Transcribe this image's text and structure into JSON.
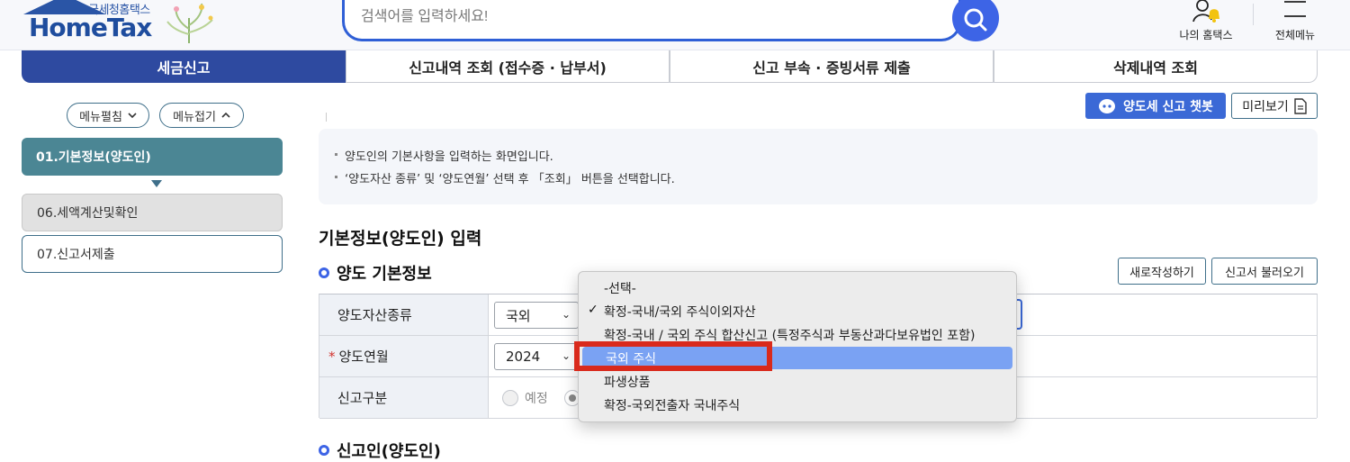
{
  "header": {
    "logo_sub": "국세청홈택스",
    "logo_main": "HomeTax",
    "search_placeholder": "검색어를 입력하세요!",
    "my_hometax": "나의 홈택스",
    "all_menu": "전체메뉴"
  },
  "tabs": [
    {
      "label": "세금신고"
    },
    {
      "label": "신고내역 조회 (접수증 · 납부서)"
    },
    {
      "label": "신고 부속 · 증빙서류 제출"
    },
    {
      "label": "삭제내역 조회"
    }
  ],
  "sidebar": {
    "expand_label": "메뉴펼침",
    "collapse_label": "메뉴접기",
    "steps": [
      {
        "label": "01.기본정보(양도인)"
      },
      {
        "label": "06.세액계산및확인"
      },
      {
        "label": "07.신고서제출"
      }
    ]
  },
  "toolbar": {
    "chatbot_label": "양도세 신고 챗봇",
    "preview_label": "미리보기"
  },
  "info": {
    "line1": "양도인의 기본사항을 입력하는 화면입니다.",
    "line2": "‘양도자산 종류’ 및 ‘양도연월’ 선택 후 「조회」 버튼을 선택합니다."
  },
  "section": {
    "title": "기본정보(양도인) 입력",
    "sub1": "양도 기본정보",
    "sub2": "신고인(양도인)",
    "new_btn": "새로작성하기",
    "load_btn": "신고서 불러오기"
  },
  "form": {
    "asset_type_label": "양도자산종류",
    "asset_type_value": "국외",
    "month_label": "양도연월",
    "required_mark": "*",
    "year_value": "2024",
    "report_type_label": "신고구분",
    "radio1_label": "예정"
  },
  "dropdown": {
    "options": [
      {
        "label": "-선택-"
      },
      {
        "label": "확정-국내/국외 주식이외자산",
        "checked": true
      },
      {
        "label": "확정-국내 / 국외 주식 합산신고 (특정주식과 부동산과다보유법인 포함)"
      },
      {
        "label": "국외 주식",
        "highlighted": true
      },
      {
        "label": "파생상품"
      },
      {
        "label": "확정-국외전출자 국내주식"
      }
    ]
  },
  "colors": {
    "brand": "#2e4aa0",
    "search_blue": "#3d64e6",
    "sidebar_active": "#4b8694",
    "highlight": "#7aa2f3",
    "annotation_red": "#d92a1c"
  }
}
